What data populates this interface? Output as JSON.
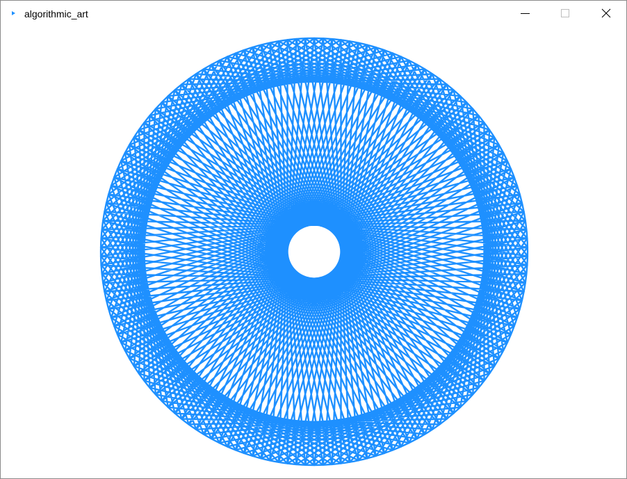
{
  "window": {
    "title": "algorithmic_art",
    "icon": "play-triangle-icon",
    "controls": {
      "minimize_icon": "minimize-icon",
      "maximize_icon": "maximize-icon",
      "close_icon": "close-icon"
    }
  },
  "art": {
    "stroke_color": "#1e90ff",
    "background_color": "#ffffff",
    "icon_color": "#1e90ff"
  }
}
